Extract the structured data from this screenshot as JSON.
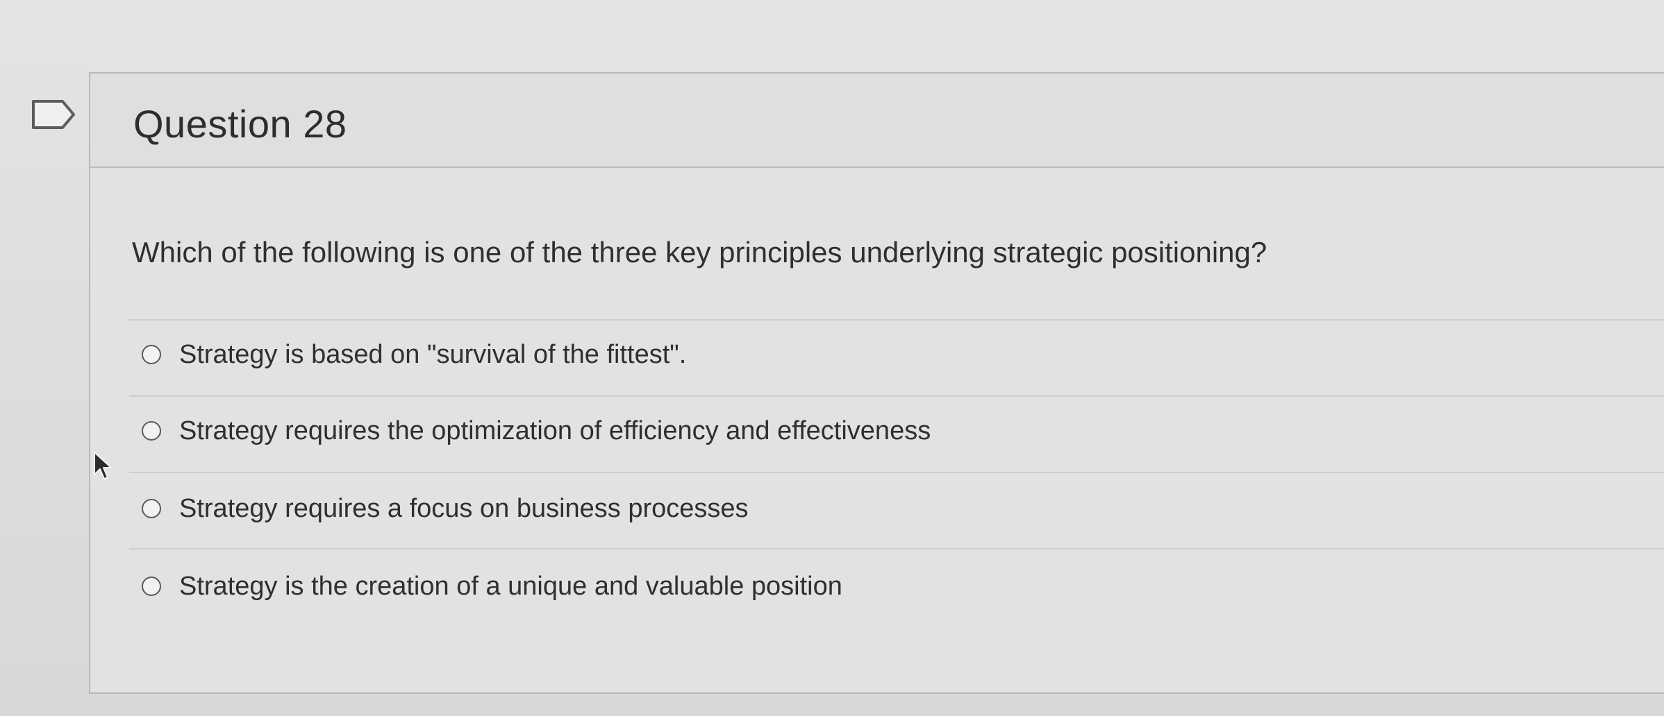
{
  "question": {
    "title": "Question 28",
    "text": "Which of the following is one of the three key principles underlying strategic positioning?"
  },
  "answers": [
    {
      "label": "Strategy is based on \"survival of the fittest\".",
      "selected": false
    },
    {
      "label": "Strategy requires the optimization of efficiency and effectiveness",
      "selected": false
    },
    {
      "label": "Strategy requires a focus on business processes",
      "selected": false
    },
    {
      "label": "Strategy is the creation of a unique and valuable position",
      "selected": false
    }
  ],
  "icons": {
    "flag": "flag-icon",
    "radio": "radio-button-icon",
    "cursor": "mouse-cursor-icon"
  },
  "colors": {
    "text": "#2f2f2f",
    "border": "#b9b9b9",
    "background": "#e2e2e2"
  }
}
